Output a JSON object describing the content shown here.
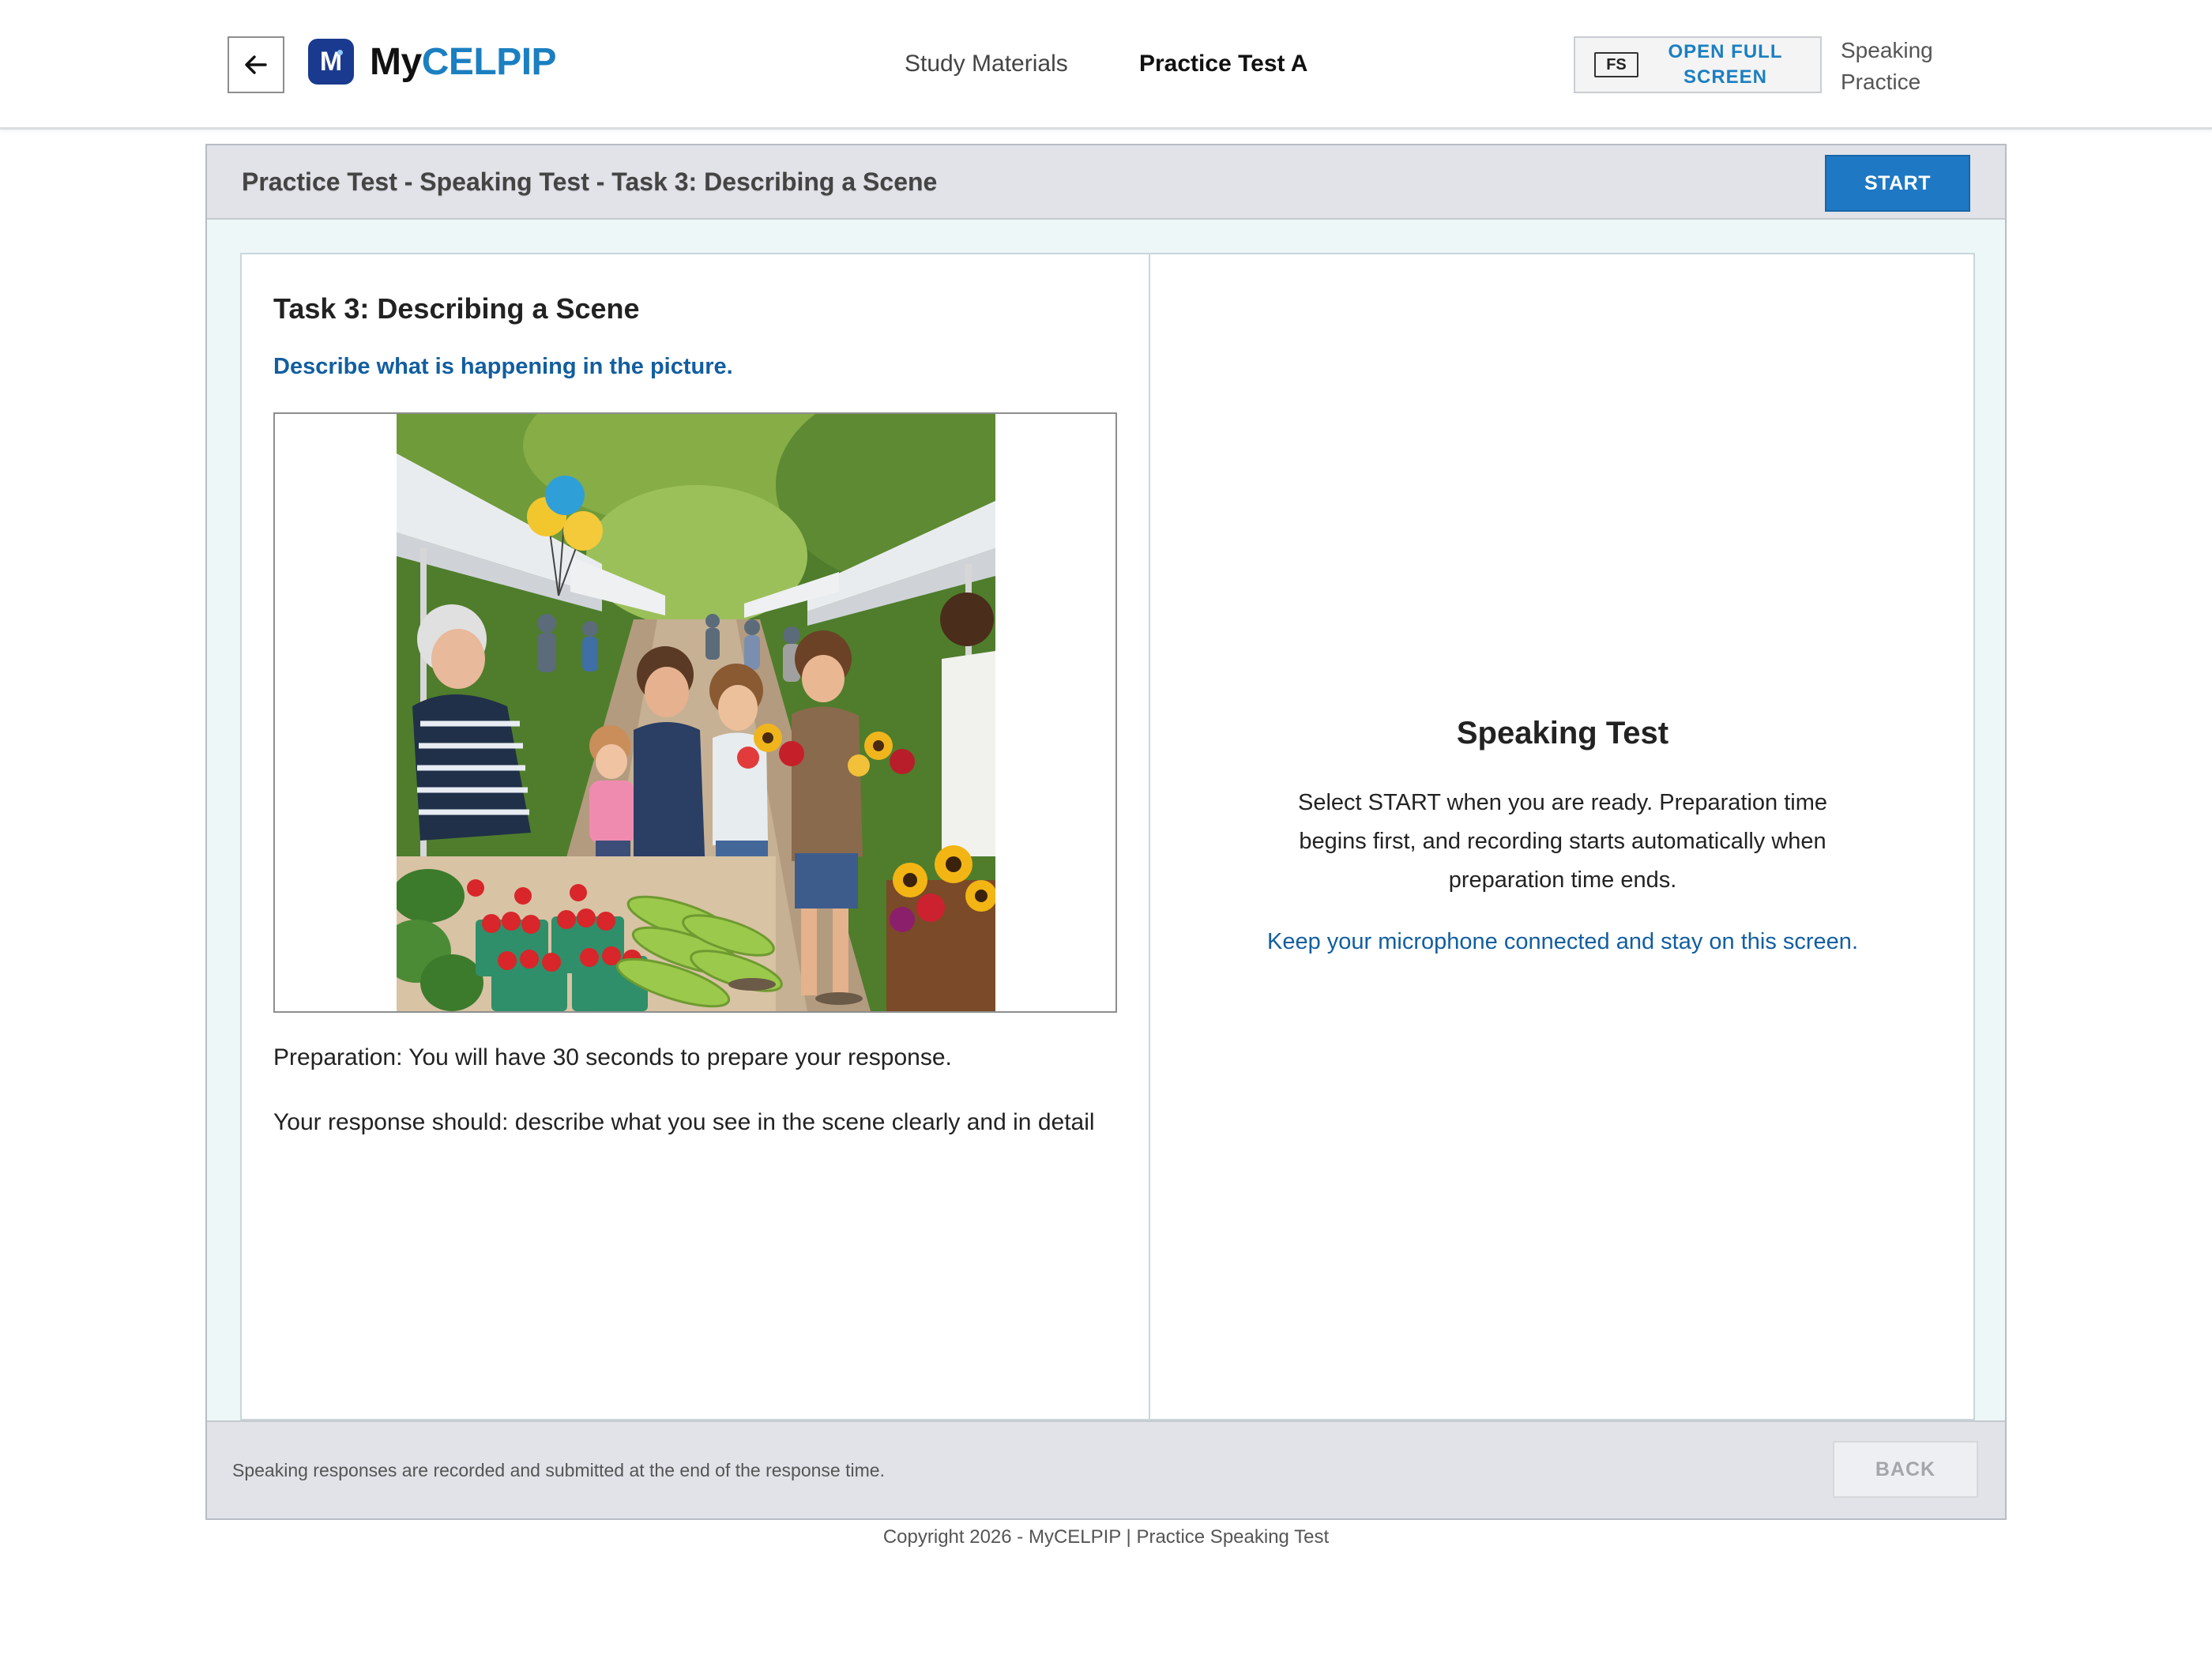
{
  "header": {
    "back_icon": "arrow-left-icon",
    "logo": {
      "mark_letter": "M",
      "text_my": "My",
      "text_brand": "CELPIP",
      "brand_color": "#1b7fc1",
      "mark_color": "#1a3a8f"
    },
    "nav": [
      {
        "label": "Study Materials",
        "active": false
      },
      {
        "label": "Practice Test A",
        "active": true
      }
    ],
    "fullscreen": {
      "badge": "FS",
      "label_line1": "OPEN FULL",
      "label_line2": "SCREEN"
    },
    "mode_line1": "Speaking",
    "mode_line2": "Practice"
  },
  "panel": {
    "title": "Practice Test - Speaking Test - Task 3: Describing a Scene",
    "start_label": "START",
    "start_color": "#1f78c4"
  },
  "task": {
    "heading": "Task 3: Describing a Scene",
    "instruction": "Describe what is happening in the picture.",
    "preparation": "Preparation: You will have 30 seconds to prepare your response.",
    "response": "Your response should: describe what you see in the scene clearly and in detail"
  },
  "speaking": {
    "heading": "Speaking Test",
    "body": "Select START when you are ready. Preparation time begins first, and recording starts automatically when preparation time ends.",
    "note": "Keep your microphone connected and stay on this screen."
  },
  "footer": {
    "note": "Speaking responses are recorded and submitted at the end of the response time.",
    "back_label": "BACK"
  },
  "copyright": "Copyright 2026 - MyCELPIP | Practice Speaking Test"
}
